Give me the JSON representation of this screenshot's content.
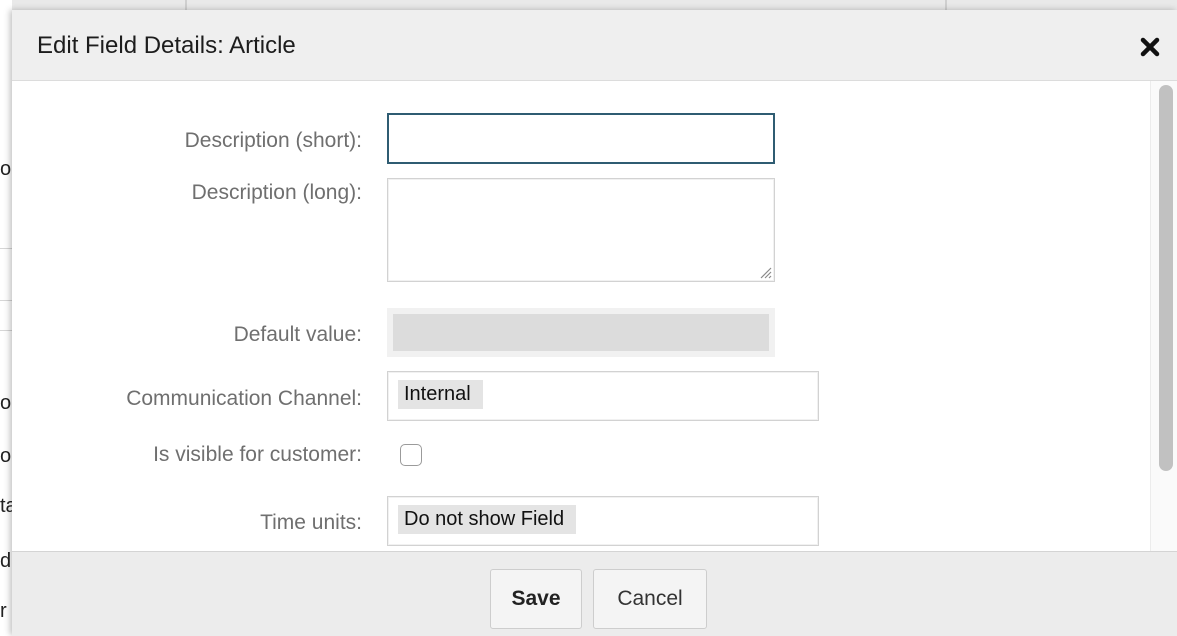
{
  "background": {
    "edge_chars": [
      "o",
      "o.",
      "o.",
      "ta",
      "d",
      "r"
    ]
  },
  "dialog": {
    "title": "Edit Field Details: Article",
    "close_icon": "close-icon"
  },
  "form": {
    "description_short": {
      "label": "Description (short):",
      "value": ""
    },
    "description_long": {
      "label": "Description (long):",
      "value": ""
    },
    "default_value": {
      "label": "Default value:",
      "value": "",
      "disabled": true
    },
    "communication_channel": {
      "label": "Communication Channel:",
      "value": "Internal"
    },
    "visible_for_customer": {
      "label": "Is visible for customer:",
      "checked": false
    },
    "time_units": {
      "label": "Time units:",
      "value": "Do not show Field"
    }
  },
  "footer": {
    "save_label": "Save",
    "cancel_label": "Cancel"
  },
  "colors": {
    "focus_border": "#2f5c72",
    "header_bg": "#efefef",
    "footer_bg": "#ececec"
  }
}
